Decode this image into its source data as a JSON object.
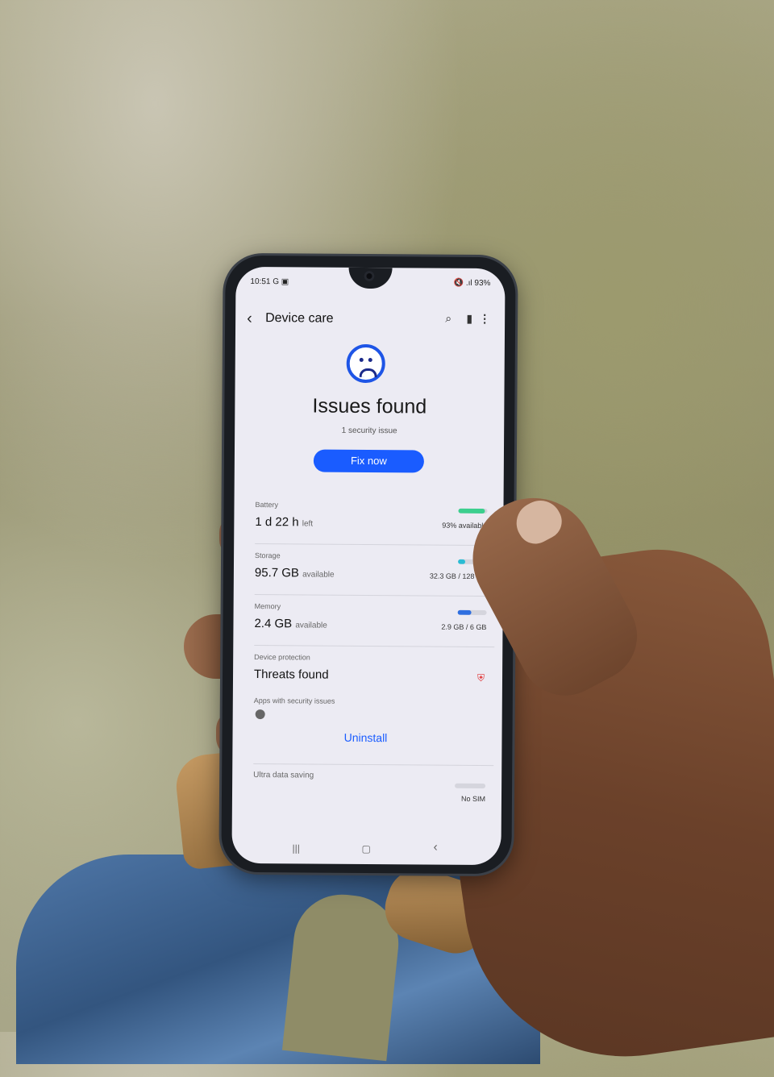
{
  "status_bar": {
    "time": "10:51",
    "left_icons": "G ▣",
    "right_icons": "🔇 .ıl",
    "battery": "93%"
  },
  "app_bar": {
    "title": "Device care"
  },
  "status": {
    "headline": "Issues found",
    "subtitle": "1 security issue",
    "fix_button": "Fix now"
  },
  "battery": {
    "label": "Battery",
    "value": "1 d 22 h",
    "unit": "left",
    "detail": "93% available",
    "level": 0.93,
    "color": "#3ccf8e"
  },
  "storage": {
    "label": "Storage",
    "value": "95.7 GB",
    "unit": "available",
    "detail": "32.3 GB / 128 GB",
    "level": 0.25,
    "color": "#2bbcd4"
  },
  "memory": {
    "label": "Memory",
    "value": "2.4 GB",
    "unit": "available",
    "detail": "2.9 GB / 6 GB",
    "level": 0.48,
    "color": "#2f6fe0"
  },
  "protection": {
    "label": "Device protection",
    "value": "Threats found",
    "sub_label": "Apps with security issues",
    "action": "Uninstall"
  },
  "data_saving": {
    "label": "Ultra data saving",
    "detail": "No SIM"
  },
  "nav": {
    "recents": "|||",
    "home": "▢",
    "back": "‹"
  }
}
